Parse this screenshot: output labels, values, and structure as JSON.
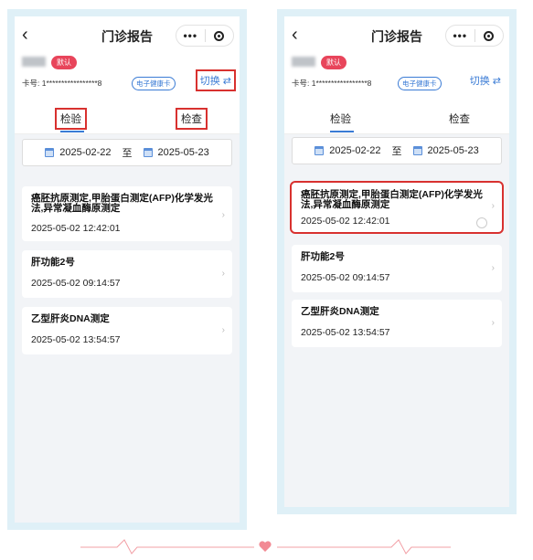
{
  "header": {
    "title": "门诊报告",
    "back_icon": "‹",
    "more_icon": "•••"
  },
  "user": {
    "badge": "默认",
    "card_no": "卡号: 1*****************8",
    "health_card": "电子健康卡",
    "switch": "切换 ⇄"
  },
  "tabs": [
    {
      "label": "检验",
      "active": true
    },
    {
      "label": "检查",
      "active": false
    }
  ],
  "dates": {
    "start": "2025-02-22",
    "sep": "至",
    "end": "2025-05-23"
  },
  "reports": [
    {
      "title": "癌胚抗原测定,甲胎蛋白测定(AFP)化学发光法,异常凝血酶原测定",
      "time": "2025-05-02 12:42:01"
    },
    {
      "title": "肝功能2号",
      "time": "2025-05-02 09:14:57"
    },
    {
      "title": "乙型肝炎DNA测定",
      "time": "2025-05-02 13:54:57"
    }
  ],
  "colors": {
    "accent": "#3a7bd5",
    "badge": "#e8455b",
    "highlight": "#d8312f",
    "frame": "#dff0f7"
  }
}
